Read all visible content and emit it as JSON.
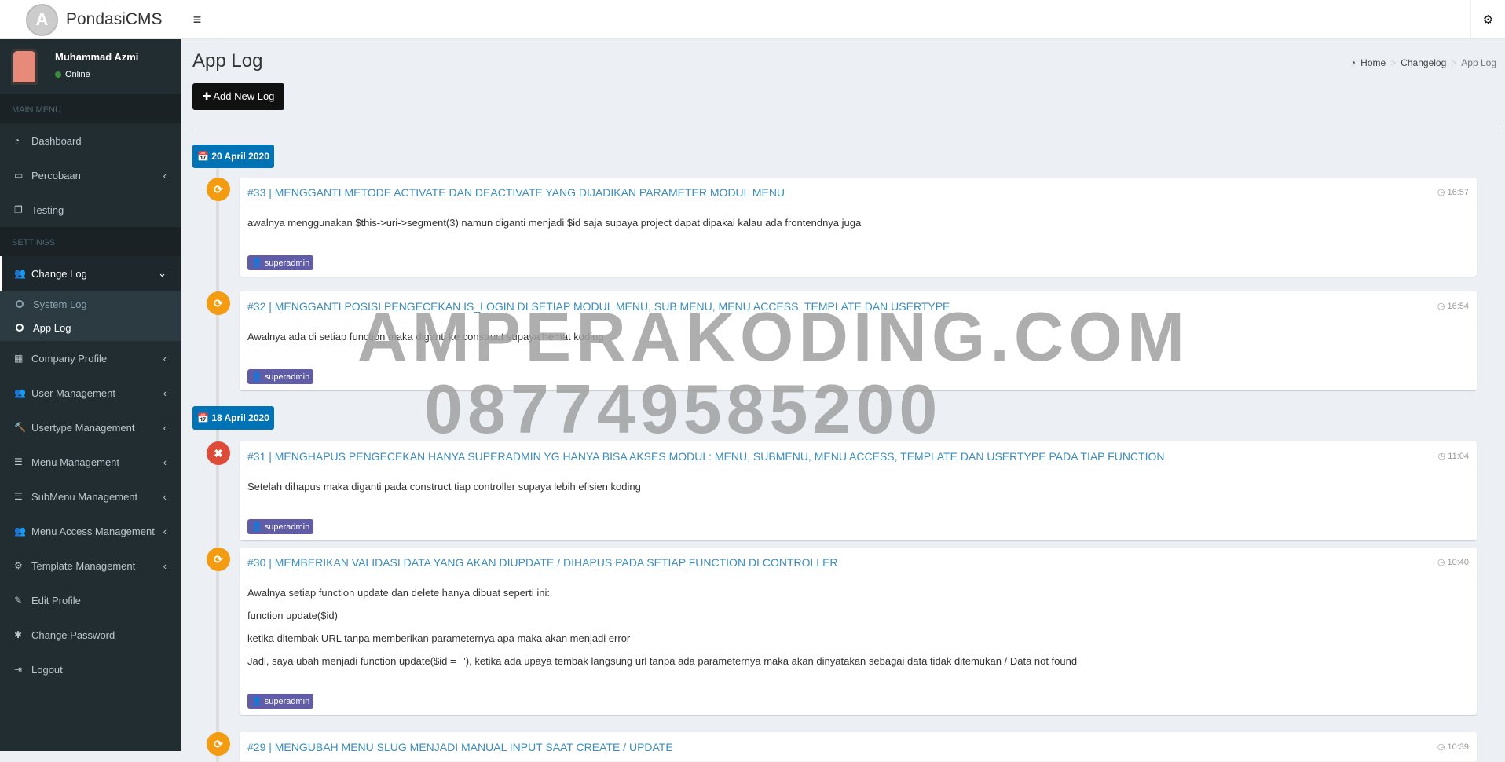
{
  "app": {
    "name": "PondasiCMS",
    "logo_letter": "A"
  },
  "header": {
    "menu_icon": "bars-icon",
    "settings_icon": "gear-icon"
  },
  "user": {
    "name": "Muhammad Azmi",
    "status": "Online"
  },
  "sidebar": {
    "main_header": "MAIN MENU",
    "main": [
      {
        "label": "Dashboard",
        "icon": "◔"
      },
      {
        "label": "Percobaan",
        "icon": "▭",
        "chev": "‹"
      },
      {
        "label": "Testing",
        "icon": "❐"
      }
    ],
    "settings_header": "SETTINGS",
    "changelog": {
      "label": "Change Log",
      "icon": "👥",
      "chev": "⌄",
      "sub": [
        "System Log",
        "App Log"
      ]
    },
    "rest": [
      {
        "label": "Company Profile",
        "icon": "▦",
        "chev": "‹"
      },
      {
        "label": "User Management",
        "icon": "👥",
        "chev": "‹"
      },
      {
        "label": "Usertype Management",
        "icon": "🔨",
        "chev": "‹"
      },
      {
        "label": "Menu Management",
        "icon": "☰",
        "chev": "‹"
      },
      {
        "label": "SubMenu Management",
        "icon": "☰",
        "chev": "‹"
      },
      {
        "label": "Menu Access Management",
        "icon": "👥",
        "chev": "‹"
      },
      {
        "label": "Template Management",
        "icon": "⚙",
        "chev": "‹"
      },
      {
        "label": "Edit Profile",
        "icon": "✎"
      },
      {
        "label": "Change Password",
        "icon": "✱"
      },
      {
        "label": "Logout",
        "icon": "⇥"
      }
    ]
  },
  "page": {
    "title": "App Log",
    "add_button": "✚ Add New Log",
    "breadcrumb": [
      "Home",
      "Changelog",
      "App Log"
    ]
  },
  "timeline": {
    "dates": [
      "📅 20 April 2020",
      "📅 18 April 2020"
    ],
    "entries": [
      {
        "title": "#33 | MENGGANTI METODE ACTIVATE DAN DEACTIVATE YANG DIJADIKAN PARAMETER MODUL MENU",
        "time": "◷ 16:57",
        "body": [
          "awalnya menggunakan $this->uri->segment(3) namun diganti menjadi $id saja supaya project dapat dipakai kalau ada frontendnya juga"
        ],
        "author": "👤 superadmin",
        "type": "update",
        "color": "#f39c12"
      },
      {
        "title": "#32 | MENGGANTI POSISI PENGECEKAN IS_LOGIN DI SETIAP MODUL MENU, SUB MENU, MENU ACCESS, TEMPLATE DAN USERTYPE",
        "time": "◷ 16:54",
        "body": [
          "Awalnya ada di setiap function maka diganti ke construct supaya hemat koding"
        ],
        "author": "👤 superadmin",
        "type": "update",
        "color": "#f39c12"
      },
      {
        "title": "#31 | MENGHAPUS PENGECEKAN HANYA SUPERADMIN YG HANYA BISA AKSES MODUL: MENU, SUBMENU, MENU ACCESS, TEMPLATE DAN USERTYPE PADA TIAP FUNCTION",
        "time": "◷ 11:04",
        "body": [
          "Setelah dihapus maka diganti pada construct tiap controller supaya lebih efisien koding"
        ],
        "author": "👤 superadmin",
        "type": "delete",
        "color": "#dd4b39"
      },
      {
        "title": "#30 | MEMBERIKAN VALIDASI DATA YANG AKAN DIUPDATE / DIHAPUS PADA SETIAP FUNCTION DI CONTROLLER",
        "time": "◷ 10:40",
        "body": [
          "Awalnya setiap function update dan delete hanya dibuat seperti ini:",
          "function update($id)",
          "ketika ditembak URL tanpa memberikan parameternya apa maka akan menjadi error",
          "Jadi, saya ubah menjadi function update($id = ' '), ketika ada upaya tembak langsung url tanpa ada parameternya maka akan dinyatakan sebagai data tidak ditemukan / Data not found"
        ],
        "author": "👤 superadmin",
        "type": "update",
        "color": "#f39c12"
      },
      {
        "title": "#29 | MENGUBAH MENU SLUG MENJADI MANUAL INPUT SAAT CREATE / UPDATE",
        "time": "◷ 10:39",
        "type": "update",
        "color": "#f39c12"
      }
    ]
  },
  "watermark": {
    "line1": "AMPERAKODING.COM",
    "line2": "087749585200"
  }
}
